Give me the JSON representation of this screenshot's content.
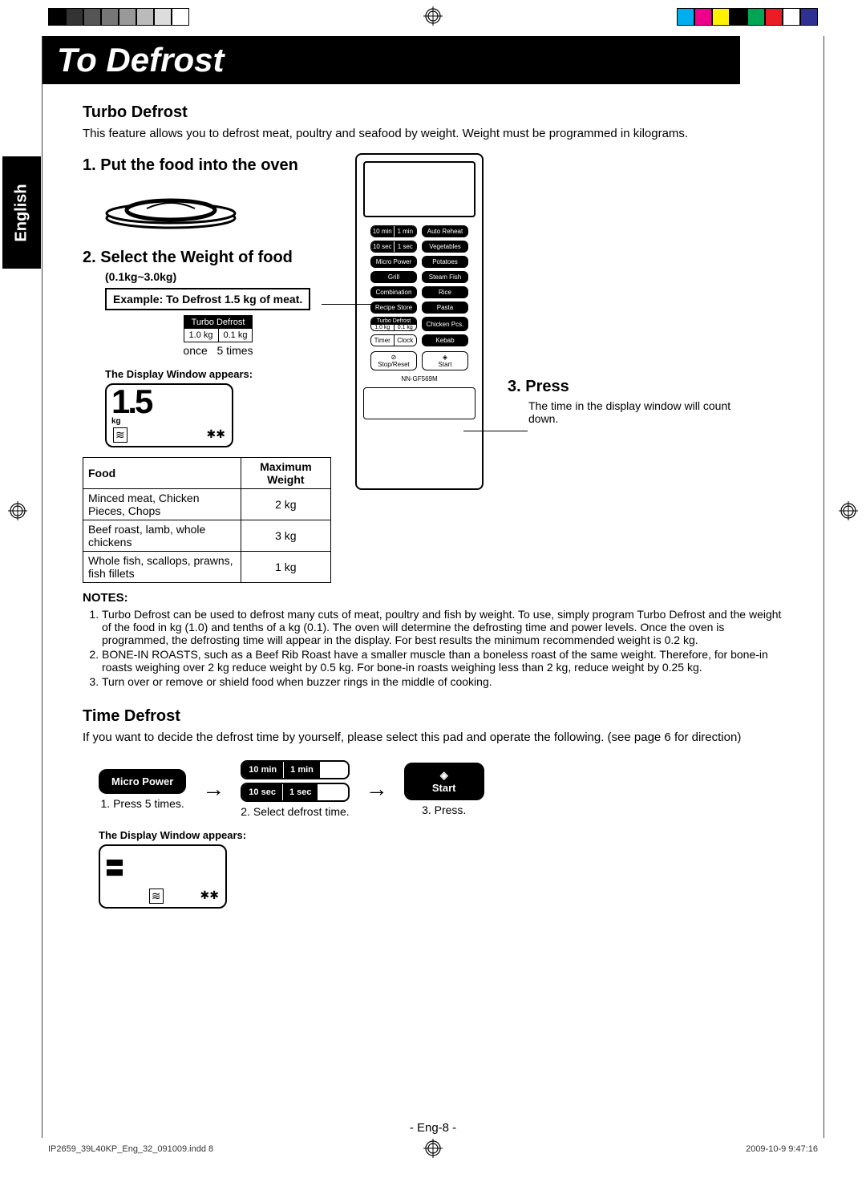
{
  "colorbar": {
    "left": [
      "#000000",
      "#333333",
      "#555555",
      "#777777",
      "#999999",
      "#bbbbbb",
      "#dddddd",
      "#ffffff"
    ],
    "right": [
      "#00aeef",
      "#ec008c",
      "#fff200",
      "#000000",
      "#00a651",
      "#ed1c24",
      "#ffffff",
      "#2e3192"
    ]
  },
  "title": "To Defrost",
  "langtab": "English",
  "turbo": {
    "heading": "Turbo Defrost",
    "desc": "This feature allows you to defrost meat, poultry and seafood by weight. Weight must be programmed in kilograms."
  },
  "step1": {
    "num": "1.",
    "title": "Put the food into the oven"
  },
  "step2": {
    "num": "2.",
    "title": "Select the Weight of food",
    "range": "(0.1kg~3.0kg)",
    "example": "Example: To Defrost 1.5 kg of meat.",
    "btnHead": "Turbo Defrost",
    "btnL": "1.0 kg",
    "btnR": "0.1 kg",
    "pressL": "once",
    "pressR": "5 times",
    "displayNote": "The Display Window appears:",
    "dispVal": "1.5",
    "dispUnit": "kg"
  },
  "foodtable": {
    "col1": "Food",
    "col2": "Maximum Weight",
    "rows": [
      {
        "food": "Minced meat, Chicken Pieces, Chops",
        "wt": "2 kg"
      },
      {
        "food": "Beef roast, lamb, whole chickens",
        "wt": "3 kg"
      },
      {
        "food": "Whole fish, scallops, prawns, fish fillets",
        "wt": "1 kg"
      }
    ]
  },
  "panel": {
    "btns": {
      "tenMin": "10 min",
      "oneMin": "1 min",
      "tenSec": "10 sec",
      "oneSec": "1 sec",
      "auto": "Auto Reheat",
      "veg": "Vegetables",
      "micro": "Micro Power",
      "potato": "Potatoes",
      "grill": "Grill",
      "steam": "Steam Fish",
      "combo": "Combination",
      "rice": "Rice",
      "recipe": "Recipe Store",
      "pasta": "Pasta",
      "turbo": "Turbo Defrost",
      "w1": "1.0 kg",
      "w01": "0.1 kg",
      "chicken": "Chicken Pcs.",
      "timer": "Timer",
      "clock": "Clock",
      "kebab": "Kebab",
      "stop": "Stop/Reset",
      "start": "Start"
    },
    "model": "NN-GF569M"
  },
  "step3": {
    "num": "3.",
    "title": "Press",
    "desc": "The time in the display window will count down."
  },
  "notes": {
    "heading": "NOTES:",
    "items": [
      "Turbo Defrost can be used to defrost many cuts of meat, poultry and fish by weight. To use, simply program Turbo Defrost and the weight of the food in kg (1.0) and tenths of a kg (0.1). The oven will determine the defrosting time and power levels. Once the oven is programmed, the defrosting time will appear in the display. For best results the minimum recommended weight is 0.2 kg.",
      "BONE-IN ROASTS, such as a Beef Rib Roast have a smaller muscle than a boneless roast of the same weight. Therefore, for bone-in roasts weighing over 2 kg reduce weight by 0.5 kg. For bone-in roasts weighing less than 2 kg, reduce weight by 0.25 kg.",
      "Turn over or remove or shield food when buzzer rings in the middle of cooking."
    ]
  },
  "time": {
    "heading": "Time Defrost",
    "desc": "If you want to decide the defrost time by yourself, please select this pad and operate the following. (see page 6 for direction)",
    "b1": "Micro Power",
    "c1": "1. Press 5 times.",
    "s10m": "10 min",
    "s1m": "1 min",
    "s10s": "10 sec",
    "s1s": "1 sec",
    "c2": "2. Select defrost time.",
    "b3": "Start",
    "c3": "3. Press.",
    "displayNote": "The Display Window appears:"
  },
  "pageNum": "- Eng-8 -",
  "footer": {
    "left": "IP2659_39L40KP_Eng_32_091009.indd   8",
    "right": "2009-10-9   9:47:16"
  }
}
